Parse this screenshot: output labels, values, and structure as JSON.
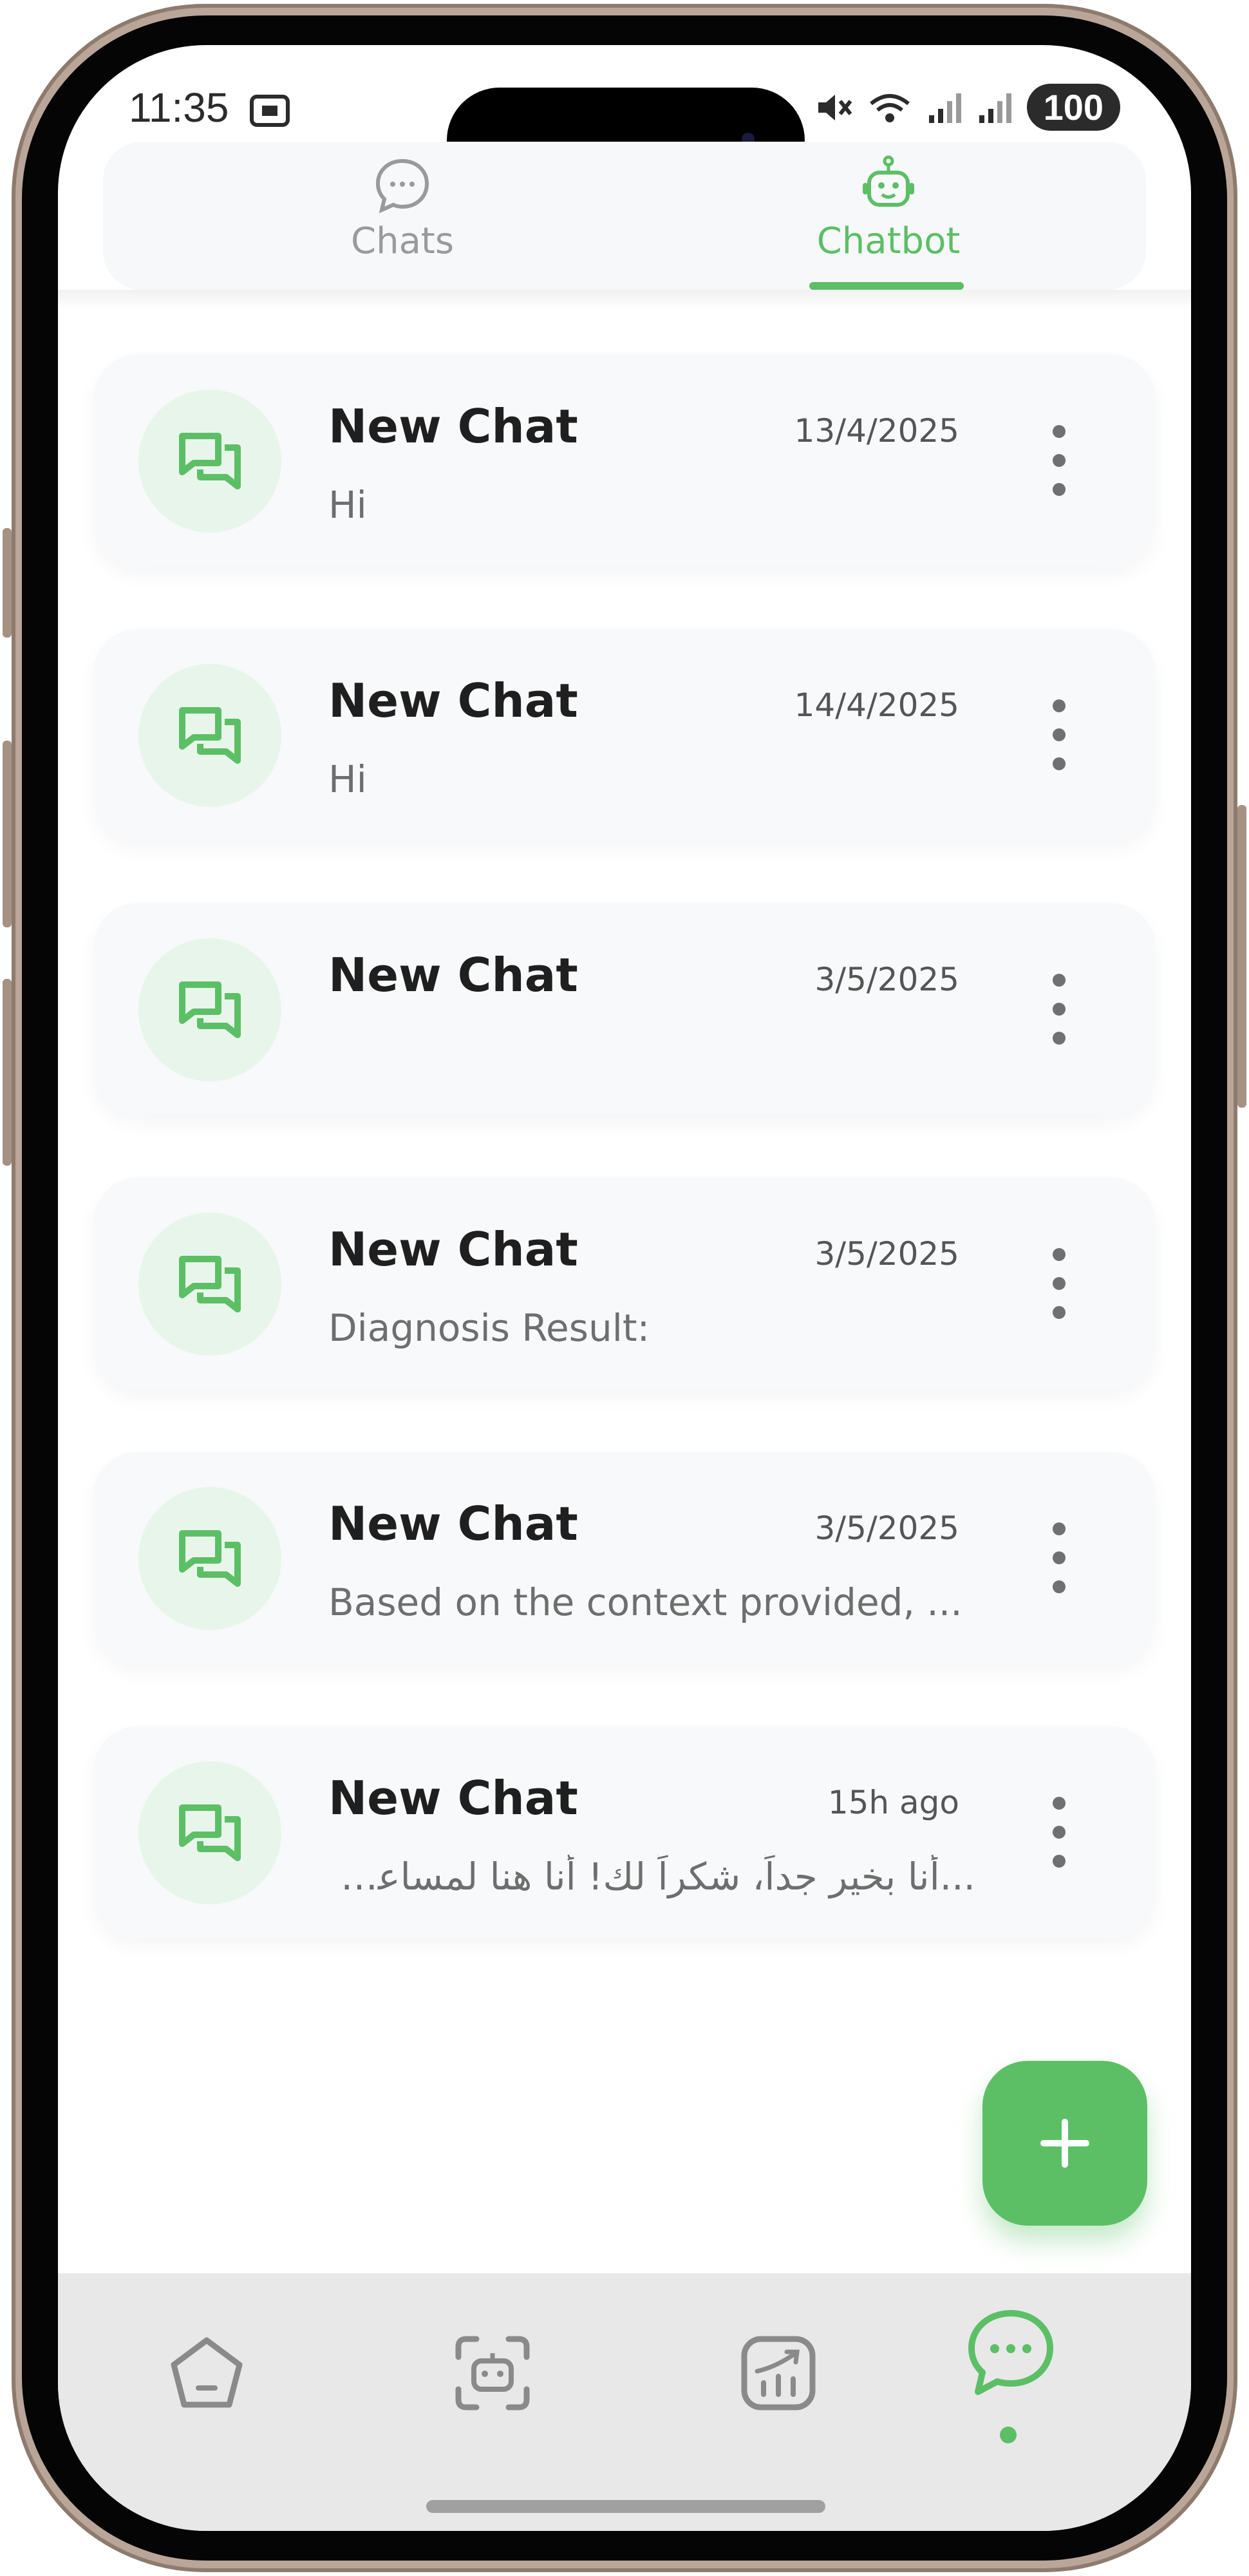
{
  "status_bar": {
    "time": "11:35",
    "battery": "100"
  },
  "top_tabs": {
    "chats_label": "Chats",
    "chatbot_label": "Chatbot",
    "active": "Chatbot"
  },
  "chats": [
    {
      "title": "New Chat",
      "date": "13/4/2025",
      "preview": "Hi",
      "rtl": false
    },
    {
      "title": "New Chat",
      "date": "14/4/2025",
      "preview": "Hi",
      "rtl": false
    },
    {
      "title": "New Chat",
      "date": "3/5/2025",
      "preview": "",
      "rtl": false
    },
    {
      "title": "New Chat",
      "date": "3/5/2025",
      "preview": "Diagnosis Result:",
      "rtl": false
    },
    {
      "title": "New Chat",
      "date": "3/5/2025",
      "preview": "Based on the context provided, ...",
      "rtl": false
    },
    {
      "title": "New Chat",
      "date": "15h ago",
      "preview": "...أنا بخير جداً، شكراً لك! أنا هنا لمساعدتك",
      "rtl": true
    }
  ],
  "fab": {
    "icon": "plus-icon"
  },
  "bottom_nav": {
    "items": [
      "home-icon",
      "scan-bot-icon",
      "analytics-icon",
      "chat-icon"
    ],
    "active": "chat-icon"
  },
  "colors": {
    "accent": "#5cbf66",
    "card_bg": "#f8f9fa",
    "avatar_bg": "#e8f5ea",
    "nav_bg": "#e8e8e8"
  }
}
